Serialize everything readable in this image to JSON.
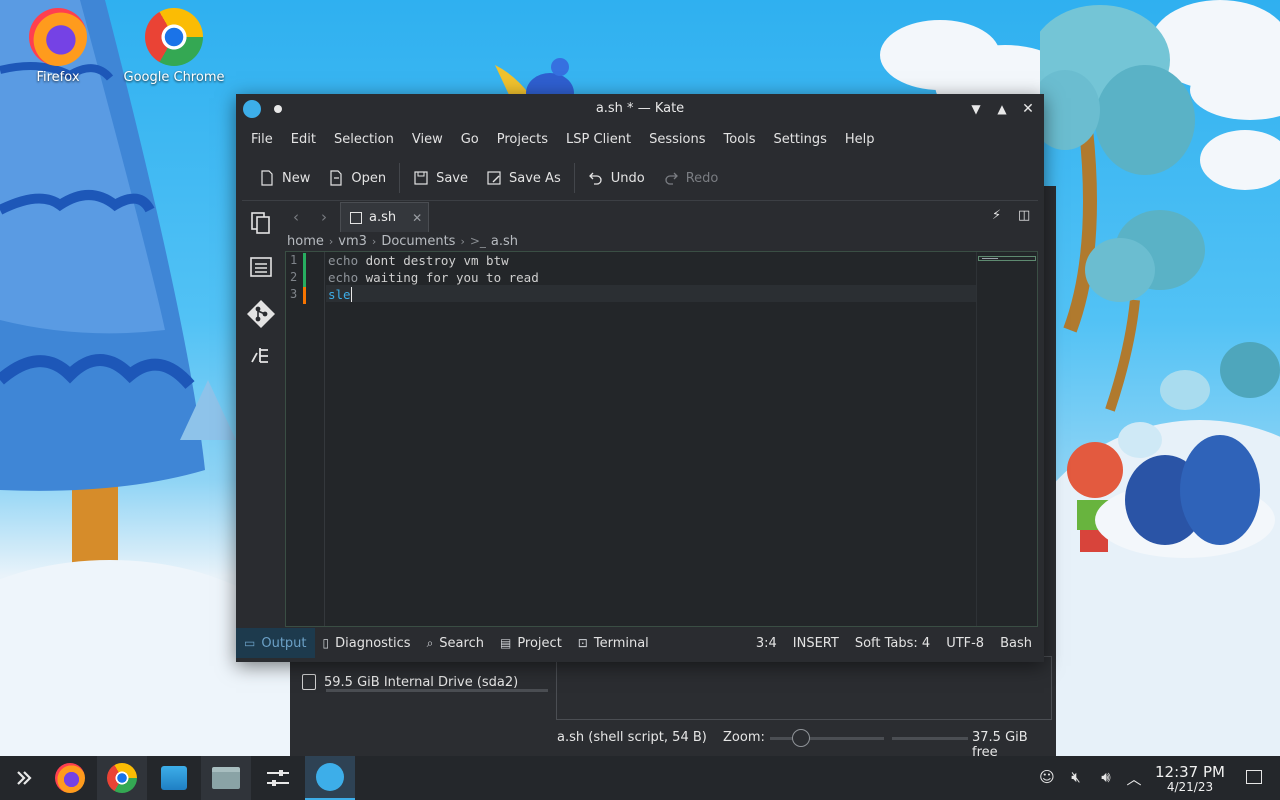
{
  "desktop": {
    "icons": [
      {
        "label": "Firefox"
      },
      {
        "label": "Google Chrome"
      }
    ]
  },
  "dolphin": {
    "drive_label": "59.5 GiB Internal Drive (sda2)",
    "file_info": "a.sh (shell script, 54 B)",
    "zoom_label": "Zoom:",
    "free_space": "37.5 GiB free"
  },
  "kate": {
    "title": "a.sh * — Kate",
    "menu": [
      "File",
      "Edit",
      "Selection",
      "View",
      "Go",
      "Projects",
      "LSP Client",
      "Sessions",
      "Tools",
      "Settings",
      "Help"
    ],
    "toolbar": {
      "new": "New",
      "open": "Open",
      "save": "Save",
      "save_as": "Save As",
      "undo": "Undo",
      "redo": "Redo"
    },
    "tab": {
      "label": "a.sh"
    },
    "breadcrumb": [
      "home",
      "vm3",
      "Documents",
      "a.sh"
    ],
    "editor": {
      "line_numbers": [
        "1",
        "2",
        "3"
      ],
      "lines": [
        {
          "kw": "echo",
          "rest": " dont destroy vm btw"
        },
        {
          "kw": "echo",
          "rest": " waiting for you to read"
        },
        {
          "kw": "",
          "rest": "sle"
        }
      ],
      "modified_colors": [
        "#27ae60",
        "#27ae60",
        "#f67400"
      ]
    },
    "bottom_tabs": [
      "Output",
      "Diagnostics",
      "Search",
      "Project",
      "Terminal"
    ],
    "status": {
      "cursor": "3:4",
      "mode": "INSERT",
      "indent": "Soft Tabs: 4",
      "encoding": "UTF-8",
      "syntax": "Bash"
    }
  },
  "taskbar": {
    "clock_time": "12:37 PM",
    "clock_date": "4/21/23"
  },
  "colors": {
    "accent": "#3daee9",
    "window_bg": "#2a2c30",
    "editor_bg": "#232629",
    "taskbar_bg": "#24272b"
  }
}
